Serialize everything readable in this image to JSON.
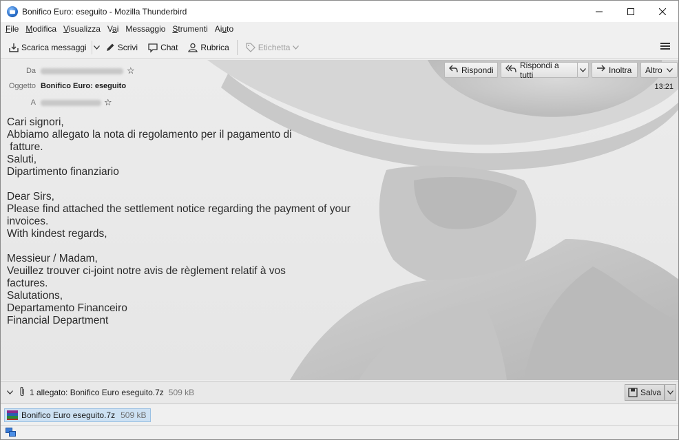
{
  "window": {
    "title": "Bonifico Euro: eseguito - Mozilla Thunderbird"
  },
  "menubar": {
    "items": [
      {
        "label": "File",
        "accel": "F",
        "rest": "ile"
      },
      {
        "label": "Modifica",
        "accel": "M",
        "rest": "odifica"
      },
      {
        "label": "Visualizza",
        "accel": "V",
        "rest": "isualizza"
      },
      {
        "label": "Vai",
        "pre": "V",
        "accel": "a",
        "rest": "i"
      },
      {
        "label": "Messaggio",
        "pre": "Messa",
        "accel": "g",
        "rest": "gio"
      },
      {
        "label": "Strumenti",
        "accel": "S",
        "rest": "trumenti"
      },
      {
        "label": "Aiuto",
        "pre": "Ai",
        "accel": "u",
        "rest": "to"
      }
    ]
  },
  "toolbar": {
    "get_messages": "Scarica messaggi",
    "write": "Scrivi",
    "chat": "Chat",
    "address_book": "Rubrica",
    "tag": "Etichetta"
  },
  "header": {
    "from_label": "Da",
    "subject_label": "Oggetto",
    "subject": "Bonifico Euro: eseguito",
    "to_label": "A",
    "time": "13:21",
    "reply": "Rispondi",
    "reply_all": "Rispondi a tutti",
    "forward": "Inoltra",
    "more": "Altro"
  },
  "body": {
    "lines": [
      "Cari signori,",
      "Abbiamo allegato la nota di regolamento per il pagamento di",
      " fatture.",
      "Saluti,",
      "Dipartimento finanziario",
      "",
      "Dear Sirs,",
      "Please find attached the settlement notice regarding the payment of your",
      "invoices.",
      "With kindest regards,",
      "",
      "Messieur / Madam,",
      "Veuillez trouver ci-joint notre avis de règlement relatif à vos",
      "factures.",
      "Salutations,",
      "Departamento Financeiro",
      "Financial Department"
    ]
  },
  "attachments": {
    "summary": "1 allegato: Bonifico Euro eseguito.7z",
    "summary_size": "509 kB",
    "save": "Salva",
    "item_name": "Bonifico Euro eseguito.7z",
    "item_size": "509 kB"
  }
}
